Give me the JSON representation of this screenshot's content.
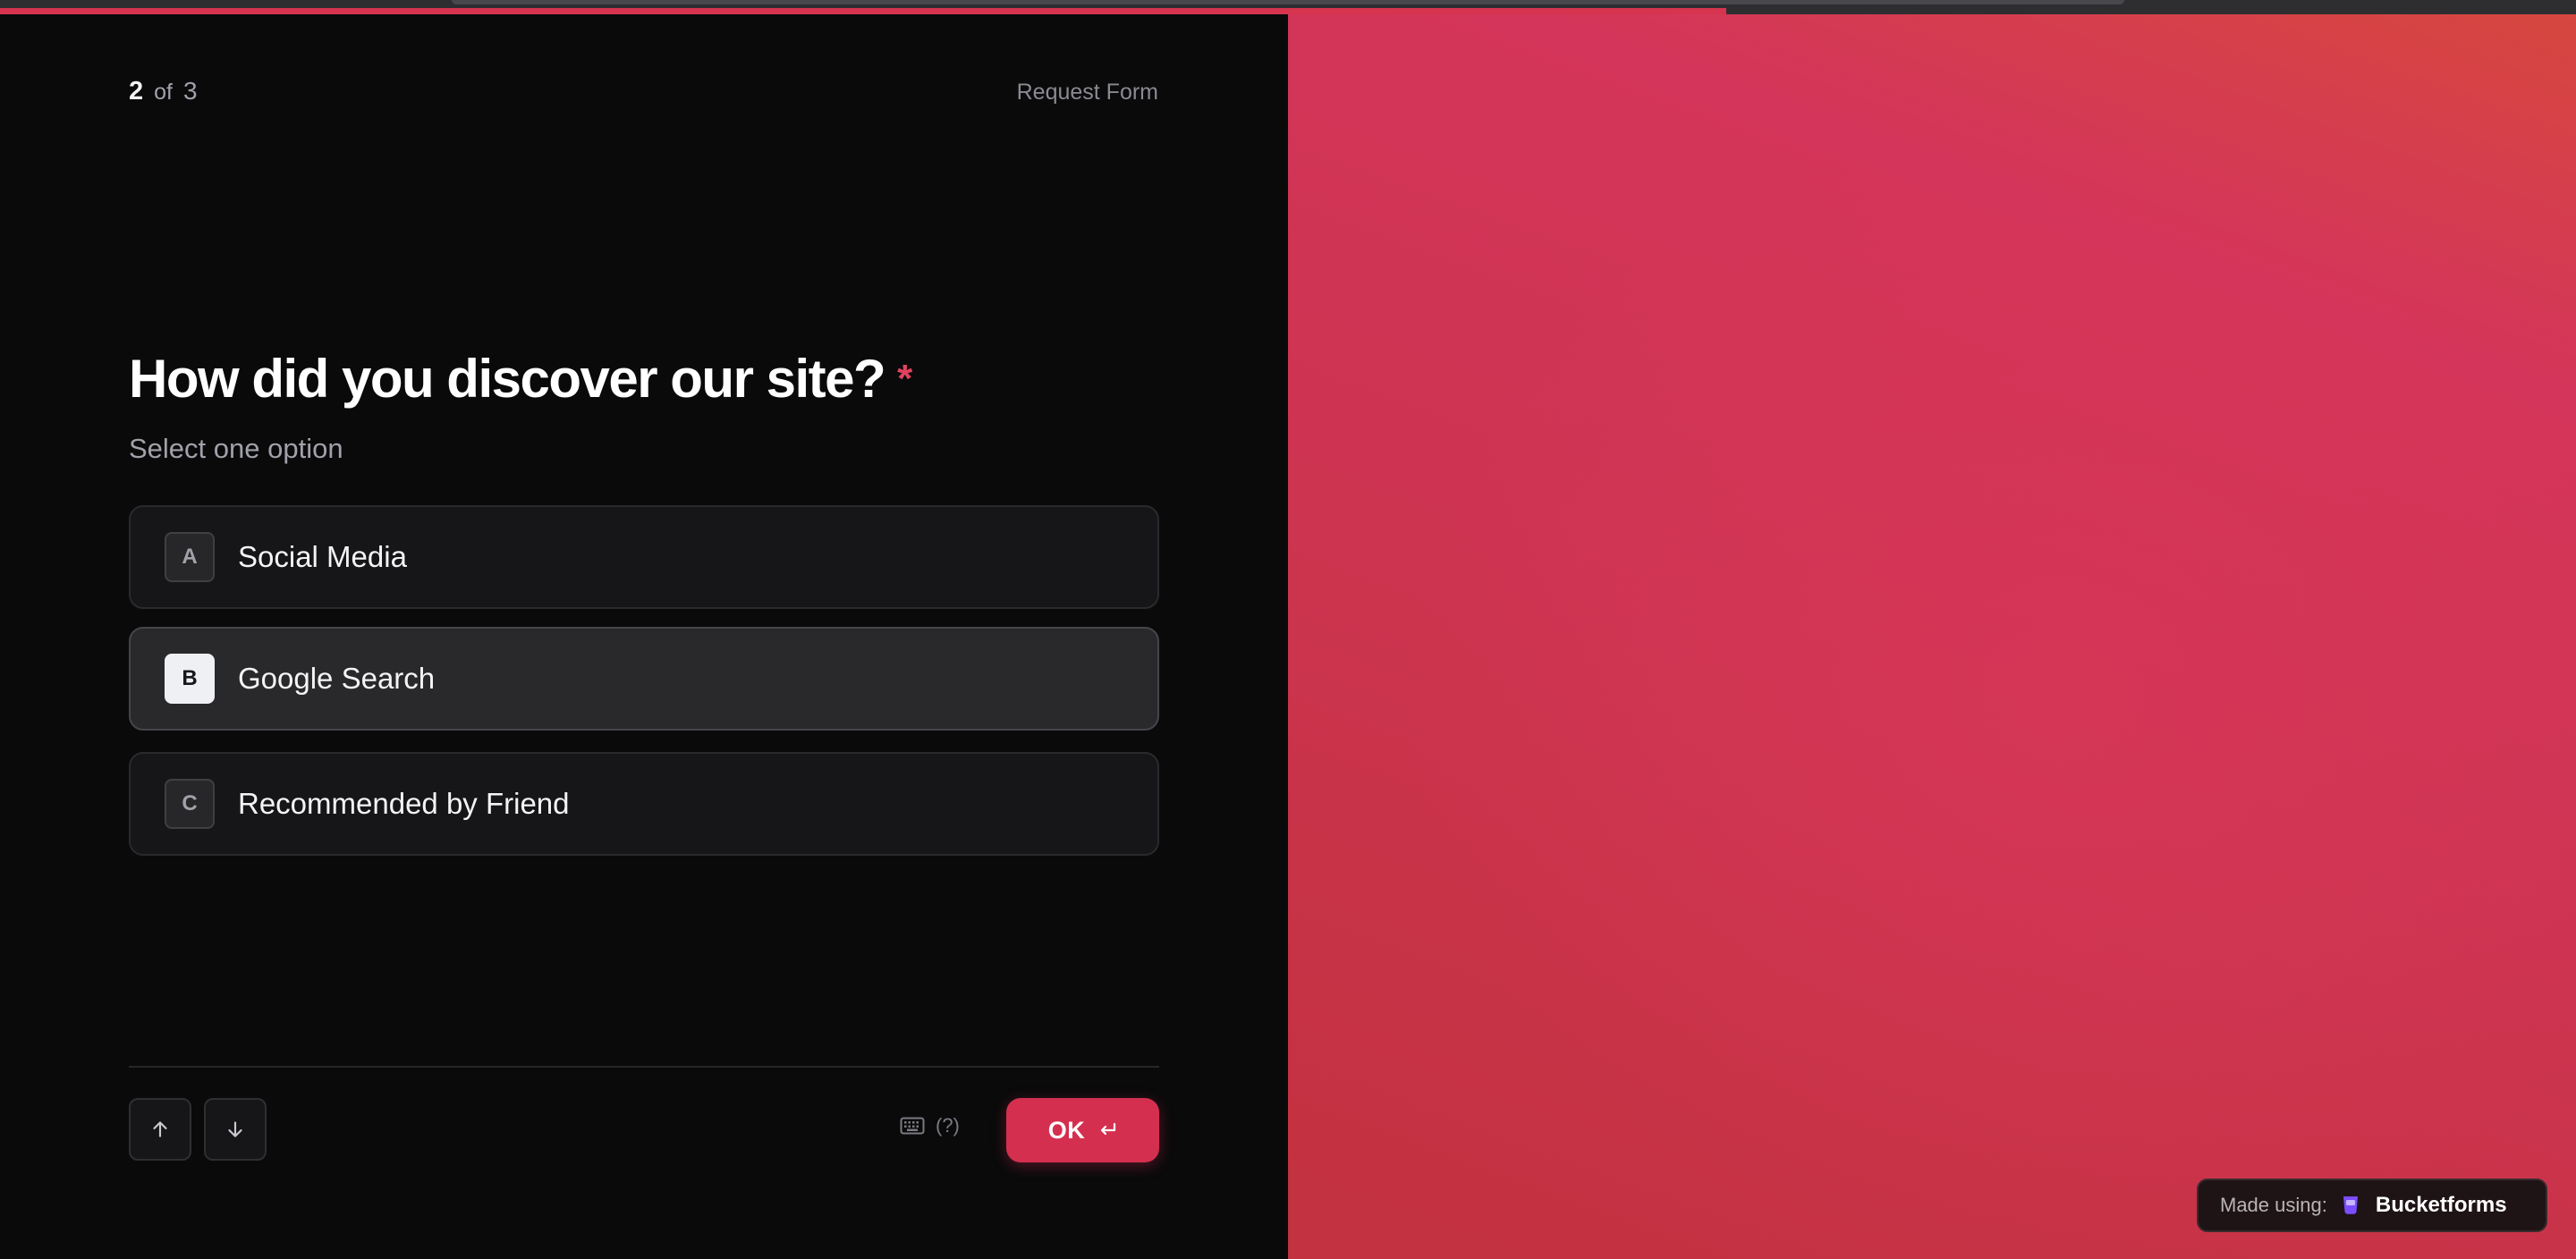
{
  "progress": {
    "fraction": 0.67
  },
  "header": {
    "current": "2",
    "of_text": "of",
    "total": "3",
    "form_name": "Request Form"
  },
  "question": {
    "title": "How did you discover our site?",
    "required_mark": "*",
    "subtitle": "Select one option"
  },
  "options": [
    {
      "key": "A",
      "label": "Social Media",
      "selected": false
    },
    {
      "key": "B",
      "label": "Google Search",
      "selected": true
    },
    {
      "key": "C",
      "label": "Recommended by Friend",
      "selected": false
    }
  ],
  "footer": {
    "up_icon": "arrow-up-icon",
    "down_icon": "arrow-down-icon",
    "keyboard_icon": "keyboard-icon",
    "shortcut_hint": "(?)",
    "ok_label": "OK",
    "enter_icon": "enter-icon"
  },
  "badge": {
    "made_using": "Made using:",
    "brand": "Bucketforms",
    "logo_icon": "bucketforms-logo-icon"
  },
  "colors": {
    "accent": "#d42f4f",
    "background": "#0a0a0b",
    "option_bg": "#161618",
    "option_selected_bg": "#29292c",
    "required": "#e0435e"
  }
}
